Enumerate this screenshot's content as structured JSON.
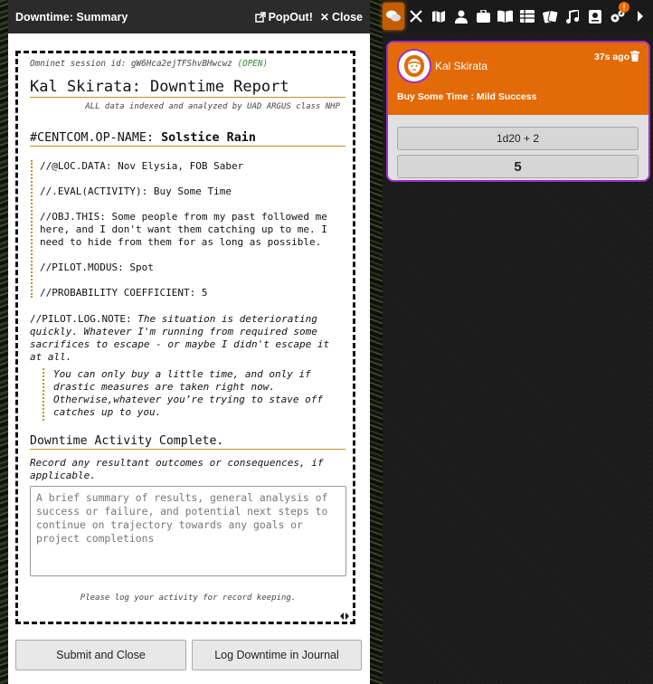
{
  "dialog": {
    "title": "Downtime: Summary",
    "popout_label": "PopOut!",
    "close_label": "Close"
  },
  "report": {
    "session_prefix": "Omninet session id: ",
    "session_id": "gW6Hca2ejTFShvBHwcwz",
    "session_status": "(OPEN)",
    "title": "Kal Skirata: Downtime Report",
    "indexed_note": "ALL data indexed and analyzed by UAD ARGUS class NHP",
    "op_name_label": "#CENTCOM.OP-NAME:",
    "op_name_value": "Solstice Rain",
    "fields": [
      {
        "label": "//@LOC.DATA:",
        "value": "Nov Elysia, FOB Saber"
      },
      {
        "label": "//.EVAL(ACTIVITY):",
        "value": "Buy Some Time"
      },
      {
        "label": "//OBJ.THIS:",
        "value": "Some people from my past followed me here, and I don't want them catching up to me. I need to hide from them for as long as possible."
      },
      {
        "label": "//PILOT.MODUS:",
        "value": "Spot"
      },
      {
        "label": "//PROBABILITY COEFFICIENT:",
        "value": "5"
      }
    ],
    "log_note_label": "//PILOT.LOG.NOTE:",
    "log_note_text": "The situation is deteriorating quickly. Whatever I'm running from required some sacrifices to escape - or maybe I didn't escape it at all.",
    "quote": "You can only buy a little time, and only if drastic measures are taken right now. Otherwise,whatever you’re trying to stave off catches up to you.",
    "complete_heading": "Downtime Activity Complete.",
    "record_instruction": "Record any resultant outcomes or consequences, if applicable.",
    "summary_placeholder": "A brief summary of results, general analysis of success or failure, and potential next steps to continue on trajectory towards any goals or project completions",
    "log_reminder": "Please log your activity for record keeping."
  },
  "buttons": {
    "submit_label": "Submit and Close",
    "journal_label": "Log Downtime in Journal"
  },
  "sidebar": {
    "tabs": [
      "chat-icon",
      "combat-icon",
      "map-icon",
      "actors-icon",
      "items-icon",
      "journal-icon",
      "tables-icon",
      "cards-icon",
      "playlists-icon",
      "compendium-icon",
      "settings-icon",
      "collapse-icon"
    ],
    "notification_badge": "!"
  },
  "chat_message": {
    "speaker": "Kal Skirata",
    "timestamp": "37s ago",
    "flavor": "Buy Some Time : Mild Success",
    "formula": "1d20 + 2",
    "total": "5"
  },
  "colors": {
    "accent_orange": "#e36a06",
    "card_border": "#9b2fc8",
    "rule_gold": "#c98a2e"
  }
}
